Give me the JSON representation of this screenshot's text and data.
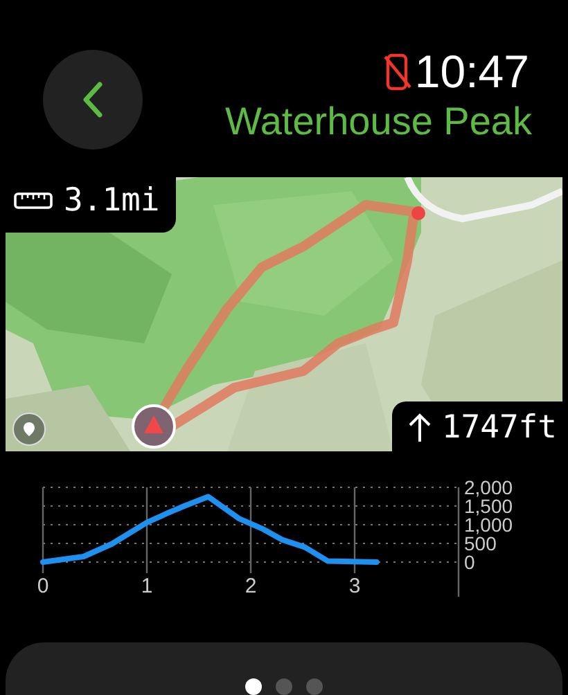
{
  "header": {
    "time": "10:47",
    "title": "Waterhouse Peak",
    "phone_disconnected": true
  },
  "map": {
    "kind": "picture",
    "distance": "3.1mi",
    "elevation_gain": "1747ft"
  },
  "elevation": {
    "chart_data": {
      "type": "line",
      "x": [
        0,
        0.39,
        0.66,
        1.0,
        1.19,
        1.36,
        1.59,
        1.89,
        2.12,
        2.3,
        2.52,
        2.74,
        3.21
      ],
      "series": [
        {
          "color": "#1e90f0",
          "values": [
            0,
            150,
            480,
            1060,
            1300,
            1500,
            1750,
            1160,
            880,
            600,
            400,
            30,
            0
          ]
        }
      ],
      "xlim": [
        0,
        4
      ],
      "ylim": [
        0,
        2000
      ],
      "xticks": [
        0,
        1,
        2,
        3
      ],
      "yticks": [
        {
          "value": 0,
          "label": "0"
        },
        {
          "value": 500,
          "label": "500"
        },
        {
          "value": 1000,
          "label": "1,000"
        },
        {
          "value": 1500,
          "label": "1,500"
        },
        {
          "value": 2000,
          "label": "2,000"
        }
      ],
      "grid": true
    }
  },
  "pages": [
    {
      "selected": true
    },
    {
      "selected": false
    },
    {
      "selected": false
    }
  ]
}
